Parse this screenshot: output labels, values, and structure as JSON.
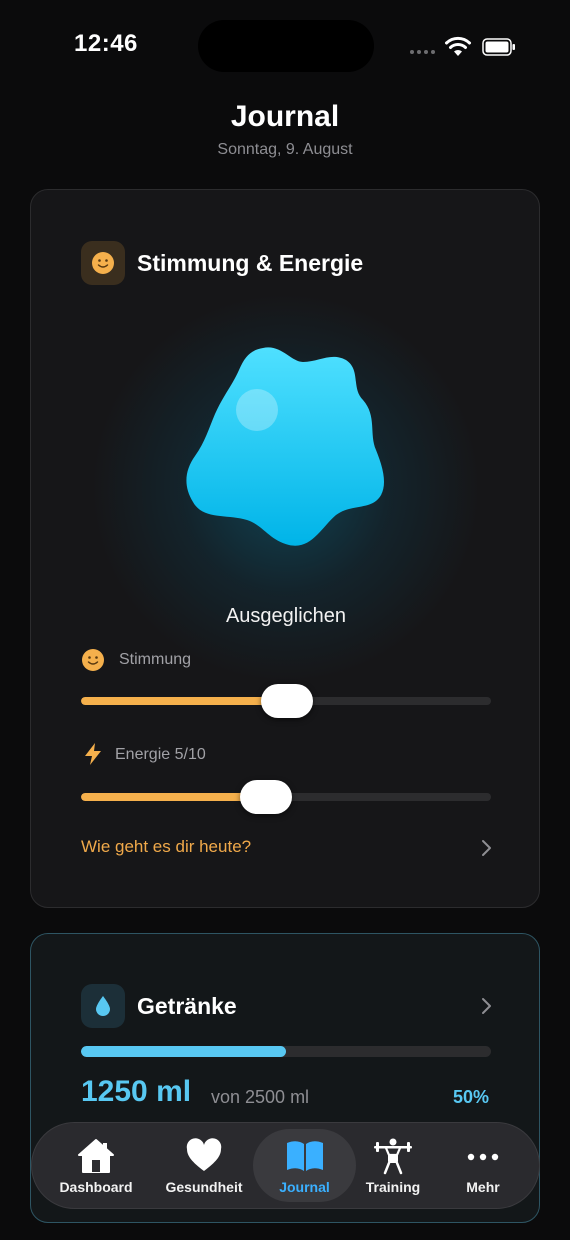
{
  "status_bar": {
    "time": "12:46"
  },
  "header": {
    "title": "Journal",
    "date": "Sonntag, 9. August"
  },
  "mood_card": {
    "title": "Stimmung & Energie",
    "mood_text": "Ausgeglichen",
    "stimmung": {
      "label": "Stimmung",
      "value_fraction": 0.5
    },
    "energie": {
      "label": "Energie 5/10",
      "value": 5,
      "max": 10
    },
    "prompt": "Wie geht es dir heute?",
    "accent_color": "#f5b04c"
  },
  "drinks_card": {
    "title": "Getränke",
    "amount": "1250 ml",
    "goal": "von 2500 ml",
    "percent": "50%",
    "progress_fraction": 0.5,
    "accent_color": "#58c8f2"
  },
  "tab_bar": {
    "tabs": [
      {
        "label": "Dashboard",
        "icon": "house-icon"
      },
      {
        "label": "Gesundheit",
        "icon": "heart-icon"
      },
      {
        "label": "Journal",
        "icon": "book-icon",
        "active": true
      },
      {
        "label": "Training",
        "icon": "weightlifter-icon"
      },
      {
        "label": "Mehr",
        "icon": "more-icon"
      }
    ],
    "active_color": "#3ab0ff"
  }
}
